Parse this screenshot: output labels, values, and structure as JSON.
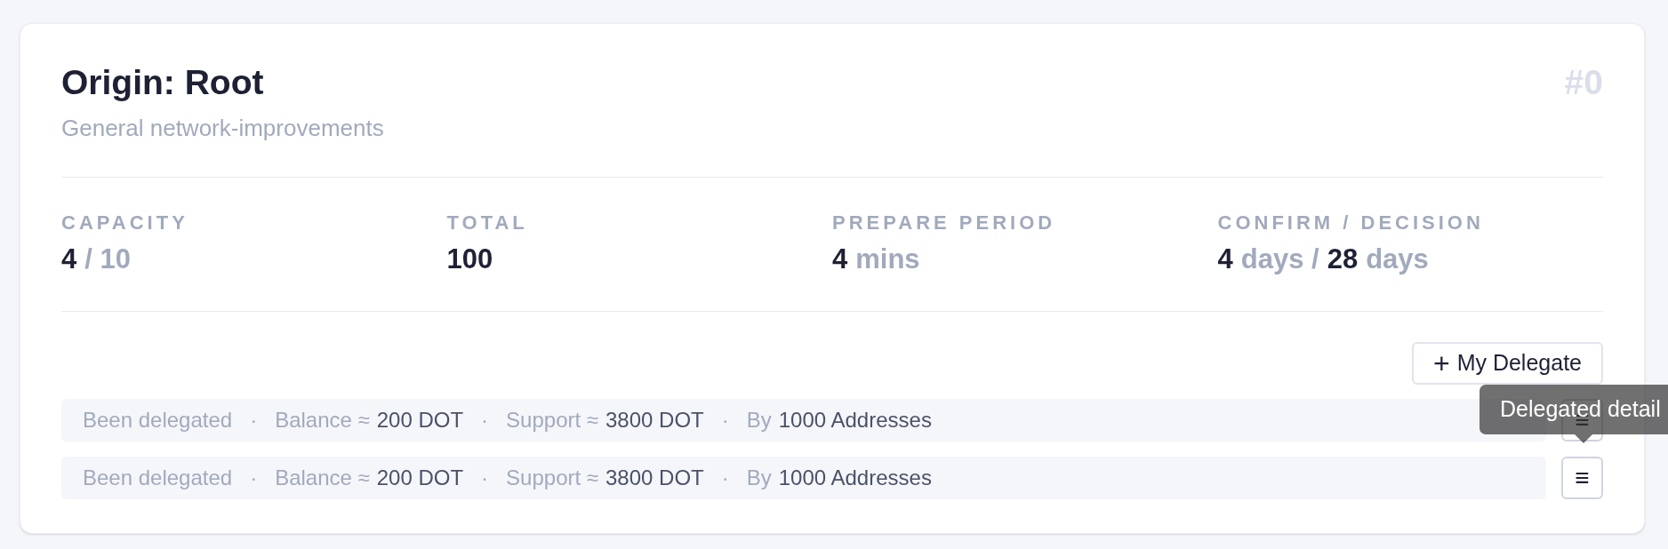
{
  "card": {
    "title": "Origin: Root",
    "number": "#0",
    "subtitle": "General network-improvements"
  },
  "stats": [
    {
      "label": "CAPACITY",
      "parts": [
        {
          "text": "4",
          "muted": false
        },
        {
          "text": "/ 10",
          "muted": true
        }
      ]
    },
    {
      "label": "TOTAL",
      "parts": [
        {
          "text": "100",
          "muted": false
        }
      ]
    },
    {
      "label": "PREPARE PERIOD",
      "parts": [
        {
          "text": "4",
          "muted": false
        },
        {
          "text": "mins",
          "muted": true
        }
      ]
    },
    {
      "label": "CONFIRM / DECISION",
      "parts": [
        {
          "text": "4",
          "muted": false
        },
        {
          "text": "days /",
          "muted": true
        },
        {
          "text": "28",
          "muted": false
        },
        {
          "text": "days",
          "muted": true
        }
      ]
    }
  ],
  "add_button": {
    "icon": "+",
    "label": "My Delegate"
  },
  "delegations": [
    {
      "segments": [
        {
          "label": "Been delegated"
        },
        {
          "separator": "·",
          "label": "Balance ≈",
          "value": "200 DOT"
        },
        {
          "separator": "·",
          "label": "Support ≈",
          "value": "3800 DOT"
        },
        {
          "separator": "·",
          "label": "By",
          "value": "1000 Addresses"
        }
      ],
      "detail_icon": "≡"
    },
    {
      "segments": [
        {
          "label": "Been delegated"
        },
        {
          "separator": "·",
          "label": "Balance ≈",
          "value": "200 DOT"
        },
        {
          "separator": "·",
          "label": "Support ≈",
          "value": "3800 DOT"
        },
        {
          "separator": "·",
          "label": "By",
          "value": "1000 Addresses"
        }
      ],
      "detail_icon": "≡"
    }
  ],
  "tooltip": {
    "text": "Delegated detail"
  }
}
